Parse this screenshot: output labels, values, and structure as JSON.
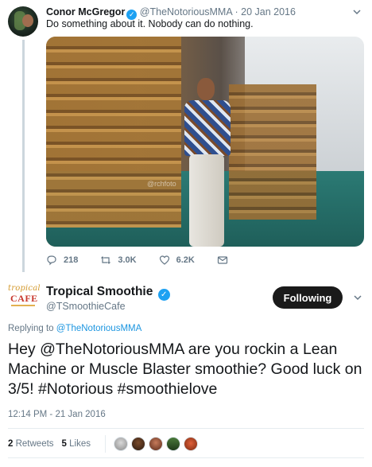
{
  "parent_tweet": {
    "name": "Conor McGregor",
    "handle": "@TheNotoriousMMA",
    "separator": "·",
    "date": "20 Jan 2016",
    "text": "Do something about it. Nobody can do nothing.",
    "photo_watermark": "@rchfoto",
    "counts": {
      "replies": "218",
      "retweets": "3.0K",
      "likes": "6.2K"
    }
  },
  "main_tweet": {
    "name": "Tropical Smoothie",
    "handle": "@TSmoothieCafe",
    "logo_top": "tropical",
    "logo_bottom": "CAFE",
    "follow_label": "Following",
    "replying_prefix": "Replying to",
    "replying_to": "@TheNotoriousMMA",
    "text": "Hey @TheNotoriousMMA are you rockin a Lean Machine or Muscle Blaster smoothie? Good luck on 3/5! #Notorious #smoothielove",
    "timestamp": "12:14 PM - 21 Jan 2016",
    "retweets_count": "2",
    "retweets_label": "Retweets",
    "likes_count": "5",
    "likes_label": "Likes"
  },
  "colors": {
    "accent": "#1da1f2",
    "link": "#1b95e0",
    "follow_bg": "#1a1a1a",
    "muted": "#657786"
  },
  "icons": {
    "verified": "verified-badge-icon",
    "reply": "reply-icon",
    "retweet": "retweet-icon",
    "like": "heart-icon",
    "message": "envelope-icon",
    "more": "chevron-down-icon"
  }
}
